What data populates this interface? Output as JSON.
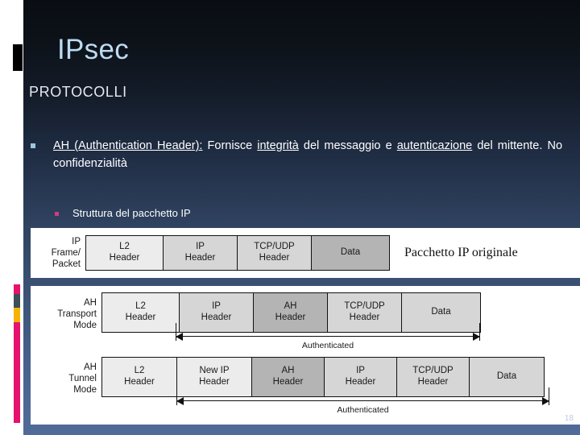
{
  "slide": {
    "title": "IPsec",
    "subtitle": "PROTOCOLLI",
    "page_number": "18",
    "colors": {
      "title": "#bcdcf2",
      "body_text": "#ffffff",
      "bullet_marker": "#9fc4e0",
      "subbullet_marker": "#d13b82",
      "bg_top": "#090d13",
      "bg_bottom": "#506b97",
      "accent_pink": "#e6136e",
      "accent_teal": "#3b5059",
      "accent_amber": "#f5b400"
    }
  },
  "bullet": {
    "marker": "square-bullet-icon",
    "segments": [
      {
        "text": "AH (Authentication Header):",
        "underline": true
      },
      {
        "text": " Fornisce ",
        "underline": false
      },
      {
        "text": "integrità",
        "underline": true
      },
      {
        "text": " del messaggio e ",
        "underline": false
      },
      {
        "text": "autenticazione",
        "underline": true
      },
      {
        "text": " del mittente. No confidenzialità",
        "underline": false
      }
    ]
  },
  "subbullet": {
    "marker": "square-bullet-icon",
    "text": "Struttura del pacchetto IP"
  },
  "figure1": {
    "row_label": "IP\nFrame/\nPacket",
    "row_label_lines": [
      "IP",
      "Frame/",
      "Packet"
    ],
    "caption": "Pacchetto IP originale",
    "cells": [
      {
        "lines": [
          "L2",
          "Header"
        ],
        "shade": "sh-light",
        "width": 96
      },
      {
        "lines": [
          "IP",
          "Header"
        ],
        "shade": "sh-mid",
        "width": 92
      },
      {
        "lines": [
          "TCP/UDP",
          "Header"
        ],
        "shade": "sh-mid",
        "width": 92
      },
      {
        "lines": [
          "Data"
        ],
        "shade": "sh-dark",
        "width": 96
      }
    ]
  },
  "figure2": {
    "rows": [
      {
        "label_lines": [
          "AH",
          "Transport",
          "Mode"
        ],
        "cells": [
          {
            "lines": [
              "L2",
              "Header"
            ],
            "shade": "sh-light",
            "width": 96
          },
          {
            "lines": [
              "IP",
              "Header"
            ],
            "shade": "sh-mid",
            "width": 92
          },
          {
            "lines": [
              "AH",
              "Header"
            ],
            "shade": "sh-dark",
            "width": 92
          },
          {
            "lines": [
              "TCP/UDP",
              "Header"
            ],
            "shade": "sh-mid",
            "width": 92
          },
          {
            "lines": [
              "Data"
            ],
            "shade": "sh-mid",
            "width": 97
          }
        ],
        "span_label": "Authenticated"
      },
      {
        "label_lines": [
          "AH",
          "Tunnel",
          "Mode"
        ],
        "cells": [
          {
            "lines": [
              "L2",
              "Header"
            ],
            "shade": "sh-light",
            "width": 93
          },
          {
            "lines": [
              "New IP",
              "Header"
            ],
            "shade": "sh-light",
            "width": 93
          },
          {
            "lines": [
              "AH",
              "Header"
            ],
            "shade": "sh-dark",
            "width": 90
          },
          {
            "lines": [
              "IP",
              "Header"
            ],
            "shade": "sh-mid",
            "width": 90
          },
          {
            "lines": [
              "TCP/UDP",
              "Header"
            ],
            "shade": "sh-mid",
            "width": 90
          },
          {
            "lines": [
              "Data"
            ],
            "shade": "sh-mid",
            "width": 92
          }
        ],
        "span_label": "Authenticated"
      }
    ]
  }
}
